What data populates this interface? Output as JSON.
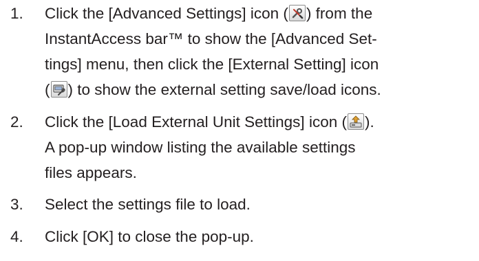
{
  "steps": [
    {
      "number": "1.",
      "lines": {
        "l1_a": "Click the [Advanced Settings] icon (",
        "l1_icon": "wrench-screwdriver-icon",
        "l1_b": ") from the",
        "l2": "InstantAccess bar™ to show the [Advanced Set-",
        "l3": "tings] menu, then click the [External Setting] icon",
        "l4_a": "(",
        "l4_icon": "external-setting-icon",
        "l4_b": ") to show the external setting save/load icons."
      }
    },
    {
      "number": "2.",
      "lines": {
        "l1_a": "Click the [Load External Unit Settings] icon (",
        "l1_icon": "load-external-icon",
        "l1_b": ").",
        "l2": "A pop-up window listing the available settings",
        "l3": "files appears."
      }
    },
    {
      "number": "3.",
      "lines": {
        "l1": "Select the settings file to load."
      }
    },
    {
      "number": "4.",
      "lines": {
        "l1": "Click [OK] to close the pop-up."
      }
    }
  ]
}
